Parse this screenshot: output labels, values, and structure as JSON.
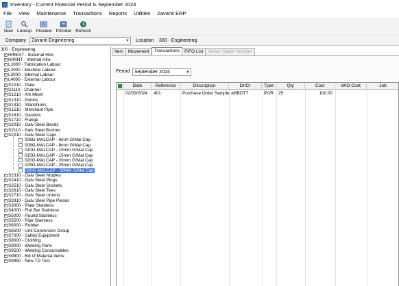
{
  "window": {
    "title": "Inventory - Current Financial Period is September 2024"
  },
  "menu": [
    "File",
    "View",
    "Maintenance",
    "Transactions",
    "Reports",
    "Utilities",
    "Zavanti ERP"
  ],
  "toolbar": [
    {
      "label": "New",
      "icon": "new-icon"
    },
    {
      "label": "Lookup",
      "icon": "lookup-icon"
    },
    {
      "label": "Preview",
      "icon": "preview-icon"
    },
    {
      "label": "P/Order",
      "icon": "purchase-order-icon"
    },
    {
      "label": "Refresh",
      "icon": "refresh-icon"
    }
  ],
  "company": {
    "label": "Company",
    "value": "Zavanti Engineering"
  },
  "location": {
    "label": "Location",
    "value": "300 - Engineering"
  },
  "tree": {
    "root": "300 - Engineering",
    "items": [
      "HIREXT - External Hire",
      "HIRINT - Internal Hire",
      "L1000 - Fabrication Labour",
      "L2000 - Machine Labour",
      "L3000 - Internal Labour",
      "L4000 - External Labour",
      "S1010 - Plate",
      "S1110 - Channel",
      "S1210 - Ark Mesh",
      "S1310 - Purlins",
      "S1410 - Stanchions",
      "S1510 - Merchant Pipe",
      "S1610 - Gaskets",
      "S1710 - Flange",
      "S2010 - Galv Steel Bends",
      "S2110 - Galv Steel Bushes",
      "S2210 - Galv Steel Caps"
    ],
    "children": [
      "006G-MALCAP - 6mm G/Mal Cap",
      "008G-MALCAP - 8mm G/Mal Cap",
      "010G-MALCAP - 10mm G/Mal Cap",
      "015G-MALCAP - 15mm G/Mal Cap",
      "020G-MALCAP - 20mm G/Mal Cap",
      "025G-MALCAP - 25mm G/Mal Cap",
      "030G-MALCAP - 30MM G/Mal Cap"
    ],
    "items_after": [
      "S2310 - Galv Steel Nipples",
      "S2410 - Galv Steel Plugs",
      "S2510 - Galv Steel Sockets",
      "S2610 - Galv Steel Tees",
      "S2710 - Galv Steel Unions",
      "S2810 - Galv Steel Pipe Pieces",
      "S3000 - Plate Stainless",
      "S4000 - Flat Bar Stainless",
      "S5000 - Round Stainless",
      "S5500 - Pipe Stainless",
      "S6000 - Rubber",
      "S6500 - Unit Conversion Group",
      "S7000 - Safety Equipment",
      "S8000 - Clothing",
      "S9000 - Welding Parts",
      "S9500 - Welding Consumables",
      "S9900 - Bill of Material Items",
      "S9950 - New TD Test"
    ]
  },
  "tabs": [
    {
      "label": "Item",
      "state": "normal"
    },
    {
      "label": "Movement",
      "state": "normal"
    },
    {
      "label": "Transactions",
      "state": "active"
    },
    {
      "label": "FIFO List",
      "state": "normal"
    },
    {
      "label": "Serial / Batch Number",
      "state": "disabled"
    }
  ],
  "period": {
    "label": "Period",
    "value": "September 2024"
  },
  "grid": {
    "columns": [
      "Date",
      "Reference",
      "Description",
      "Dr/Cr",
      "Type",
      "Qty",
      "Cost",
      "W/O Cost",
      "Job"
    ],
    "rows": [
      [
        "02/09/2024",
        "401",
        "Purchase Order Sample",
        "ABBOTT",
        "POR",
        "25",
        "100.00",
        "",
        ""
      ]
    ]
  },
  "colors": {
    "selection": "#3874d8",
    "toolbar_bg": "#f3f3f3",
    "grid_header": "#f1f1f1"
  }
}
